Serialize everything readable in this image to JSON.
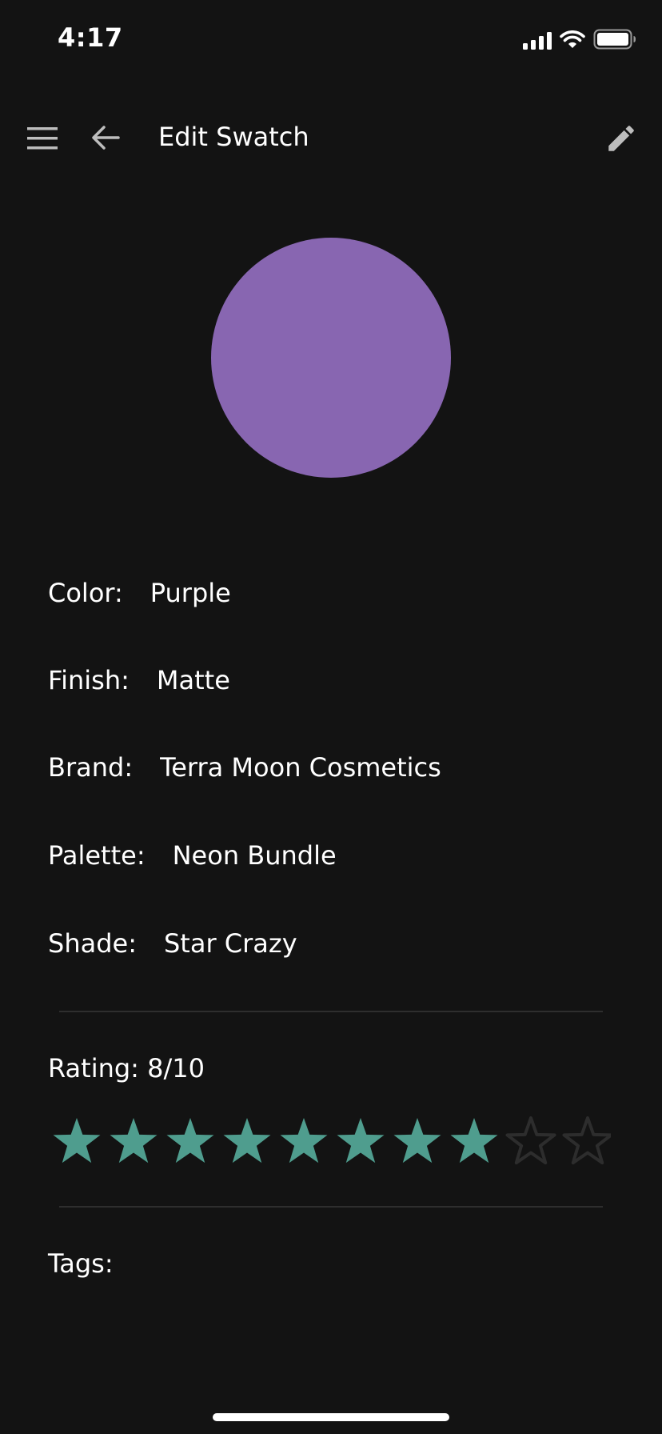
{
  "status_bar": {
    "time": "4:17",
    "icons": [
      "cellular-signal-icon",
      "wifi-icon",
      "battery-icon"
    ]
  },
  "app_bar": {
    "title": "Edit Swatch",
    "icons": [
      "menu-icon",
      "back-arrow-icon",
      "pencil-edit-icon"
    ]
  },
  "swatch": {
    "color": "#8866b1"
  },
  "details": [
    {
      "label": "Color:",
      "value": "Purple"
    },
    {
      "label": "Finish:",
      "value": "Matte"
    },
    {
      "label": "Brand:",
      "value": "Terra Moon Cosmetics"
    },
    {
      "label": "Palette:",
      "value": "Neon Bundle"
    },
    {
      "label": "Shade:",
      "value": "Star Crazy"
    }
  ],
  "rating": {
    "label": "Rating: 8/10",
    "value": 8,
    "max": 10,
    "filled_color": "#4f9d8e",
    "empty_color": "#2d2d2d"
  },
  "tags": {
    "label": "Tags:"
  },
  "theme": {
    "background": "#131313",
    "text": "#ffffff",
    "icon": "#bdbdbd"
  }
}
